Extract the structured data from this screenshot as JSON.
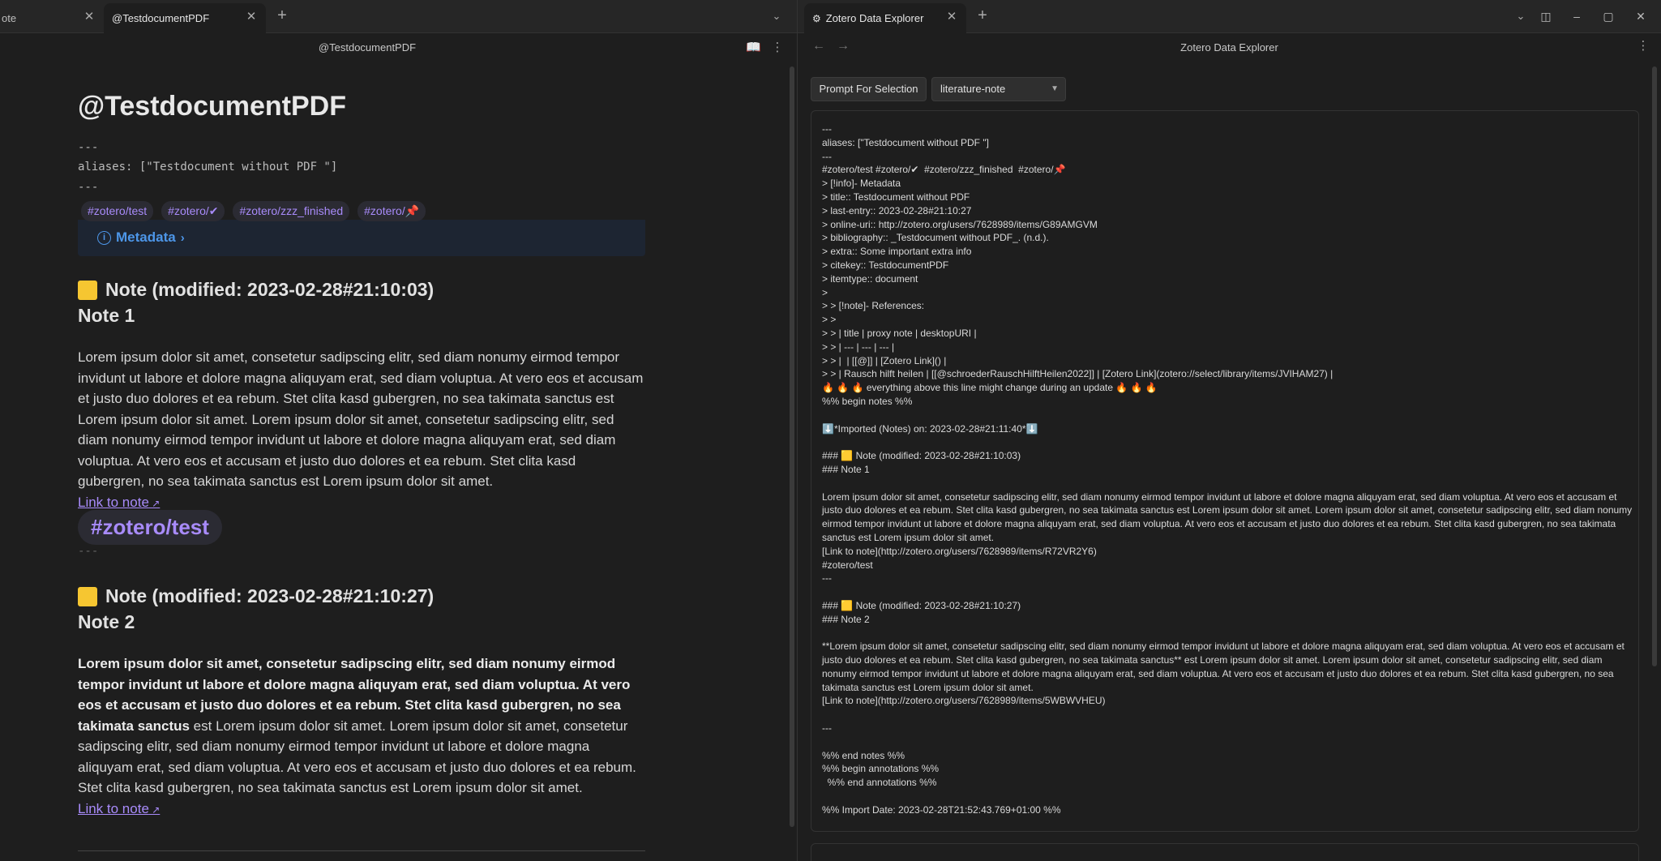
{
  "left_tabs": [
    {
      "label": "ote"
    },
    {
      "label": "@TestdocumentPDF"
    }
  ],
  "left_view_title": "@TestdocumentPDF",
  "note": {
    "title": "@TestdocumentPDF",
    "fm_open": "---",
    "aliases": "aliases: [\"Testdocument without PDF \"]",
    "fm_close": "---",
    "tags": [
      "#zotero/test",
      "#zotero/✔",
      "#zotero/zzz_finished",
      "#zotero/📌"
    ],
    "callout_label": "Metadata",
    "note1_heading": "Note (modified: 2023-02-28#21:10:03)",
    "note1_sub": "Note 1",
    "note1_text": "Lorem ipsum dolor sit amet, consetetur sadipscing elitr, sed diam nonumy eirmod tempor invidunt ut labore et dolore magna aliquyam erat, sed diam voluptua. At vero eos et accusam et justo duo dolores et ea rebum. Stet clita kasd gubergren, no sea takimata sanctus est Lorem ipsum dolor sit amet. Lorem ipsum dolor sit amet, consetetur sadipscing elitr, sed diam nonumy eirmod tempor invidunt ut labore et dolore magna aliquyam erat, sed diam voluptua. At vero eos et accusam et justo duo dolores et ea rebum. Stet clita kasd gubergren, no sea takimata sanctus est Lorem ipsum dolor sit amet.",
    "link1": "Link to note",
    "big_tag": "#zotero/test",
    "sep": "---",
    "note2_heading": "Note (modified: 2023-02-28#21:10:27)",
    "note2_sub": "Note 2",
    "note2_bold": "Lorem ipsum dolor sit amet, consetetur sadipscing elitr, sed diam nonumy eirmod tempor invidunt ut labore et dolore magna aliquyam erat, sed diam voluptua. At vero eos et accusam et justo duo dolores et ea rebum. Stet clita kasd gubergren, no sea takimata sanctus",
    "note2_rest": " est Lorem ipsum dolor sit amet. Lorem ipsum dolor sit amet, consetetur sadipscing elitr, sed diam nonumy eirmod tempor invidunt ut labore et dolore magna aliquyam erat, sed diam voluptua. At vero eos et accusam et justo duo dolores et ea rebum. Stet clita kasd gubergren, no sea takimata sanctus est Lorem ipsum dolor sit amet.",
    "link2": "Link to note"
  },
  "right_tab": {
    "label": "Zotero Data Explorer"
  },
  "right_view_title": "Zotero Data Explorer",
  "prompt_button": "Prompt For Selection",
  "template_select": "literature-note",
  "output_lines": [
    "---",
    "aliases: [\"Testdocument without PDF \"]",
    "---",
    "#zotero/test #zotero/✔  #zotero/zzz_finished  #zotero/📌",
    "> [!info]- Metadata",
    "> title:: Testdocument without PDF",
    "> last-entry:: 2023-02-28#21:10:27",
    "> online-uri:: http://zotero.org/users/7628989/items/G89AMGVM",
    "> bibliography:: _Testdocument without PDF_. (n.d.).",
    "> extra:: Some important extra info",
    "> citekey:: TestdocumentPDF",
    "> itemtype:: document",
    ">",
    "> > [!note]- References:",
    "> >",
    "> > | title | proxy note | desktopURI |",
    "> > | --- | --- | --- |",
    "> > |  | [[@]] | [Zotero Link]() |",
    "> > | Rausch hilft heilen | [[@schroederRauschHilftHeilen2022]] | [Zotero Link](zotero://select/library/items/JVIHAM27) |",
    "🔥 🔥 🔥 everything above this line might change during an update 🔥 🔥 🔥",
    "%% begin notes %%",
    "",
    "⬇️*Imported (Notes) on: 2023-02-28#21:11:40*⬇️",
    "",
    "### 🟨 Note (modified: 2023-02-28#21:10:03)",
    "### Note 1",
    "",
    "Lorem ipsum dolor sit amet, consetetur sadipscing elitr, sed diam nonumy eirmod tempor invidunt ut labore et dolore magna aliquyam erat, sed diam voluptua. At vero eos et accusam et justo duo dolores et ea rebum. Stet clita kasd gubergren, no sea takimata sanctus est Lorem ipsum dolor sit amet. Lorem ipsum dolor sit amet, consetetur sadipscing elitr, sed diam nonumy eirmod tempor invidunt ut labore et dolore magna aliquyam erat, sed diam voluptua. At vero eos et accusam et justo duo dolores et ea rebum. Stet clita kasd gubergren, no sea takimata sanctus est Lorem ipsum dolor sit amet.",
    "[Link to note](http://zotero.org/users/7628989/items/R72VR2Y6)",
    "#zotero/test",
    "---",
    "",
    "### 🟨 Note (modified: 2023-02-28#21:10:27)",
    "### Note 2",
    "",
    "**Lorem ipsum dolor sit amet, consetetur sadipscing elitr, sed diam nonumy eirmod tempor invidunt ut labore et dolore magna aliquyam erat, sed diam voluptua. At vero eos et accusam et justo duo dolores et ea rebum. Stet clita kasd gubergren, no sea takimata sanctus** est Lorem ipsum dolor sit amet. Lorem ipsum dolor sit amet, consetetur sadipscing elitr, sed diam nonumy eirmod tempor invidunt ut labore et dolore magna aliquyam erat, sed diam voluptua. At vero eos et accusam et justo duo dolores et ea rebum. Stet clita kasd gubergren, no sea takimata sanctus est Lorem ipsum dolor sit amet.",
    "[Link to note](http://zotero.org/users/7628989/items/5WBWVHEU)",
    "",
    "---",
    "",
    "%% end notes %%",
    "%% begin annotations %%",
    "  %% end annotations %%",
    "",
    "%% Import Date: 2023-02-28T21:52:43.769+01:00 %%"
  ],
  "colors": {
    "accent": "#a88bfa",
    "callout": "#4d96e8",
    "background": "#1e1e1e"
  }
}
